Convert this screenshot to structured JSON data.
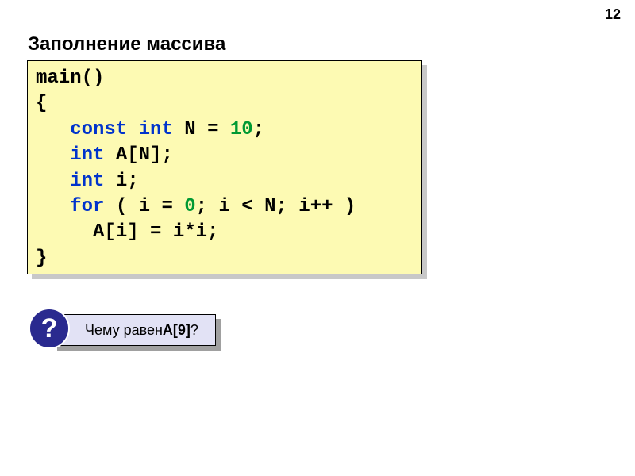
{
  "page_number": "12",
  "title": "Заполнение массива",
  "code": {
    "line1": "main()",
    "line2": "{",
    "line3_indent": "   ",
    "line3_const": "const",
    "line3_sp1": " ",
    "line3_int": "int",
    "line3_sp2": " N",
    "line3_eq": " = ",
    "line3_num": "10",
    "line3_semi": ";",
    "line4_indent": "   ",
    "line4_int": "int",
    "line4_rest": " A[N];",
    "line5_indent": "   ",
    "line5_int": "int",
    "line5_rest": " i;",
    "line6_indent": "   ",
    "line6_for": "for",
    "line6_sp": " ( i = ",
    "line6_num": "0",
    "line6_rest": "; i < N; i++ )",
    "line7": "     A[i] = i*i;",
    "line8": "}"
  },
  "question": {
    "mark": "?",
    "text_pre": " Чему равен ",
    "text_bold": "A[9]",
    "text_post": "?"
  }
}
